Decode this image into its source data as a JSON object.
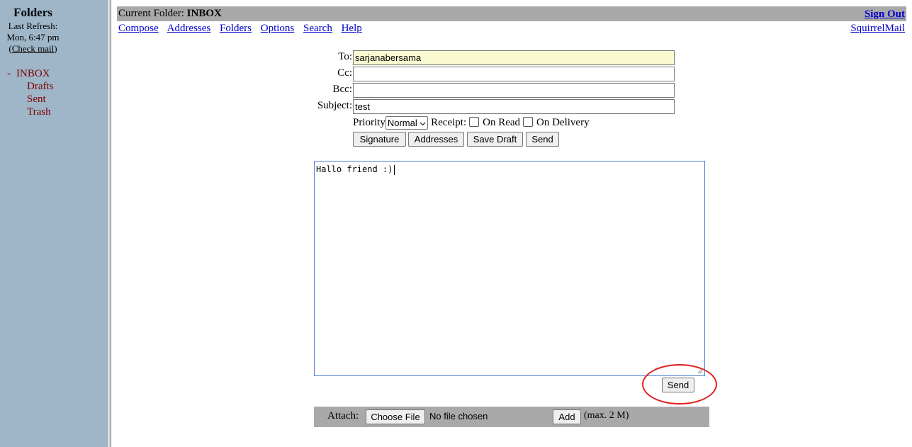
{
  "sidebar": {
    "title": "Folders",
    "last_refresh_label": "Last Refresh:",
    "last_refresh_time": "Mon, 6:47 pm",
    "check_mail_open": "(",
    "check_mail_link": "Check mail",
    "check_mail_close": ")",
    "current_marker": "-",
    "folders": [
      "INBOX",
      "Drafts",
      "Sent",
      "Trash"
    ]
  },
  "header": {
    "current_folder_label": "Current Folder:",
    "current_folder": "INBOX",
    "sign_out": "Sign Out",
    "brand": "SquirrelMail",
    "menu": [
      "Compose",
      "Addresses",
      "Folders",
      "Options",
      "Search",
      "Help"
    ]
  },
  "compose": {
    "to_label": "To:",
    "to_value": "sarjanabersama",
    "cc_label": "Cc:",
    "cc_value": "",
    "bcc_label": "Bcc:",
    "bcc_value": "",
    "subject_label": "Subject:",
    "subject_value": "test",
    "priority_label": "Priority",
    "priority_value": "Normal",
    "receipt_label": "Receipt:",
    "on_read_label": "On Read",
    "on_delivery_label": "On Delivery",
    "buttons": {
      "signature": "Signature",
      "addresses": "Addresses",
      "save_draft": "Save Draft",
      "send": "Send"
    },
    "body": "Hallo friend :)",
    "send_bottom": "Send"
  },
  "attach": {
    "label": "Attach:",
    "choose_file": "Choose File",
    "no_file": "No file chosen",
    "add": "Add",
    "max": "(max. 2 M)"
  },
  "colors": {
    "sidebar_bg": "#9eb6c8",
    "header_bar": "#a9a9a9",
    "link": "#0000cc",
    "folder_text": "#800000",
    "to_field_bg": "#fafad2",
    "annotation_circle": "#e02020"
  }
}
